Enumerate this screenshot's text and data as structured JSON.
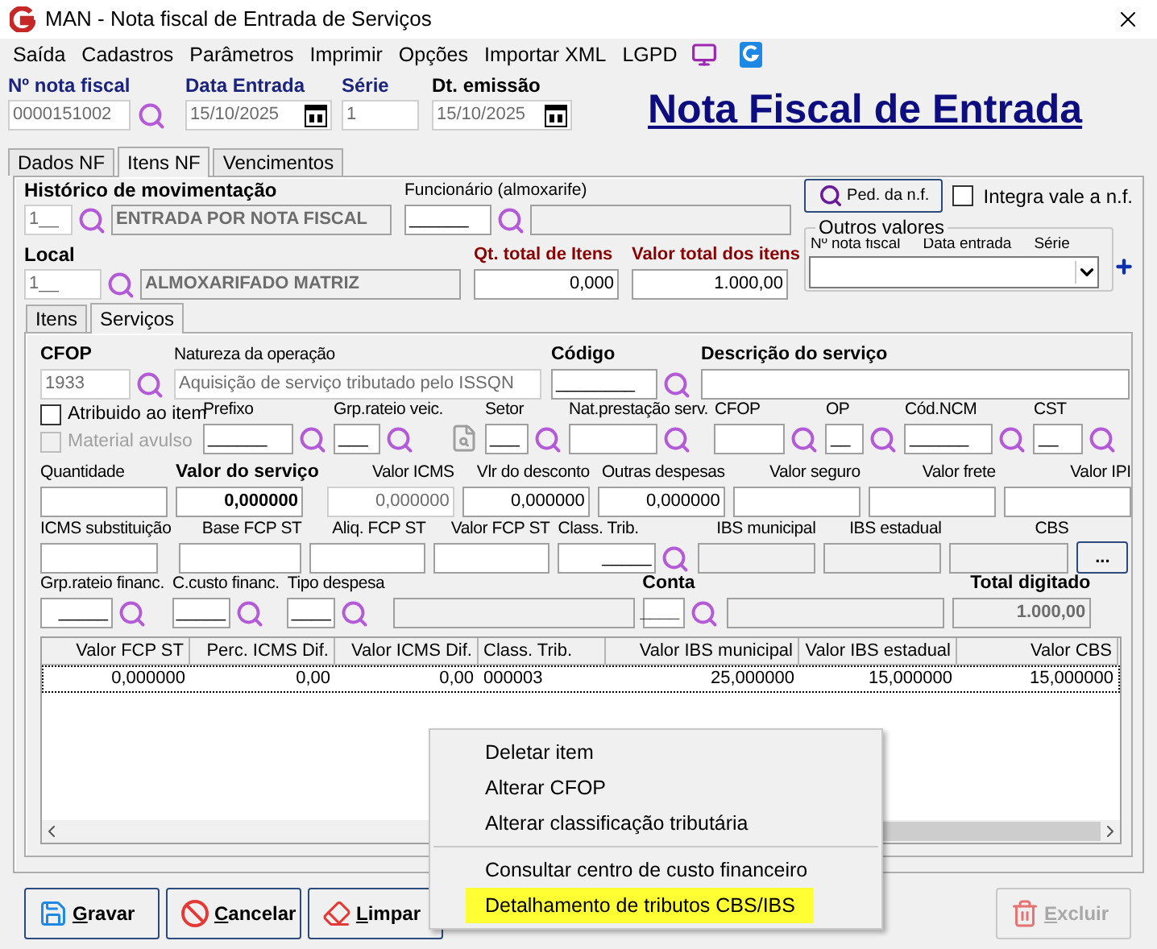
{
  "window": {
    "title": "MAN - Nota fiscal de Entrada de Serviços"
  },
  "menu": [
    "Saída",
    "Cadastros",
    "Parâmetros",
    "Imprimir",
    "Opções",
    "Importar XML",
    "LGPD"
  ],
  "header": {
    "fields": [
      {
        "label": "Nº nota fiscal",
        "value": "0000151002",
        "kind": "search",
        "required": true,
        "readonly": true
      },
      {
        "label": "Data Entrada",
        "value": "15/10/2025",
        "kind": "date",
        "required": true,
        "readonly": true
      },
      {
        "label": "Série",
        "value": "1",
        "kind": "plain",
        "required": true,
        "readonly": true
      },
      {
        "label": "Dt. emissão",
        "value": "15/10/2025",
        "kind": "date",
        "required": false,
        "readonly": true
      }
    ],
    "heading": "Nota Fiscal de Entrada"
  },
  "tabs": [
    {
      "label": "Dados NF",
      "selected": false
    },
    {
      "label": "Itens NF",
      "selected": true
    },
    {
      "label": "Vencimentos",
      "selected": false
    }
  ],
  "historico": {
    "label": "Histórico de movimentação",
    "code": "1__",
    "description": "ENTRADA POR NOTA FISCAL"
  },
  "funcionario": {
    "label": "Funcionário (almoxarife)",
    "code": "______"
  },
  "local": {
    "label": "Local",
    "code": "1__",
    "description": "ALMOXARIFADO MATRIZ"
  },
  "totals": [
    {
      "label": "Qt. total de Itens",
      "value": "0,000"
    },
    {
      "label": "Valor total dos itens",
      "value": "1.000,00"
    }
  ],
  "pedido_button": "Ped. da n.f.",
  "integra_vale": {
    "label": "Integra vale a n.f.",
    "checked": false
  },
  "outros_valores": {
    "title": "Outros valores",
    "columns": [
      "Nº nota fiscal",
      "Data entrada",
      "Série"
    ]
  },
  "inner_tabs": [
    {
      "label": "Itens",
      "selected": false
    },
    {
      "label": "Serviços",
      "selected": true
    }
  ],
  "options": [
    {
      "label": "Atribuido ao item",
      "checked": false,
      "disabled": false
    },
    {
      "label": "Material avulso",
      "checked": false,
      "disabled": true
    }
  ],
  "rows": [
    [
      {
        "label": "CFOP",
        "value": "1933",
        "kind": "search",
        "bold": true,
        "readonly": true,
        "disabled": false
      },
      {
        "label": "Natureza da operação",
        "value": "Aquisição de serviço tributado pelo ISSQN",
        "kind": "plain",
        "bold": false,
        "readonly": true,
        "disabled": false
      },
      {
        "label": "Código",
        "value": "________",
        "kind": "search",
        "bold": true,
        "readonly": false,
        "disabled": false
      },
      {
        "label": "Descrição do serviço",
        "kind": "plain",
        "bold": true,
        "readonly": false,
        "disabled": false
      }
    ],
    [
      {
        "label": "Prefixo",
        "value": "______",
        "kind": "search",
        "bold": false,
        "readonly": false,
        "disabled": false
      },
      {
        "label": "Grp.rateio veic.",
        "value": "___",
        "kind": "search",
        "bold": false,
        "readonly": false,
        "disabled": false
      },
      {
        "label": "Setor",
        "value": "___",
        "kind": "search",
        "bold": false,
        "readonly": false,
        "disabled": false
      },
      {
        "label": "Nat.prestação serv.",
        "kind": "search",
        "bold": false,
        "readonly": false,
        "disabled": false
      },
      {
        "label": "CFOP",
        "kind": "search",
        "bold": false,
        "readonly": false,
        "disabled": false
      },
      {
        "label": "OP",
        "value": "__",
        "kind": "search",
        "bold": false,
        "readonly": false,
        "disabled": false
      },
      {
        "label": "Cód.NCM",
        "value": "______",
        "kind": "search",
        "bold": false,
        "readonly": false,
        "disabled": false
      },
      {
        "label": "CST",
        "value": "__",
        "kind": "search",
        "bold": false,
        "readonly": false,
        "disabled": false
      }
    ],
    [
      {
        "label": "Quantidade",
        "kind": "plain",
        "bold": false,
        "readonly": false,
        "disabled": false
      },
      {
        "label": "Valor do serviço",
        "value": "0,000000",
        "kind": "plain",
        "bold": true,
        "readonly": false,
        "disabled": false
      },
      {
        "label": "Valor ICMS",
        "value": "0,000000",
        "kind": "plain",
        "bold": false,
        "readonly": true,
        "disabled": false
      },
      {
        "label": "Vlr do desconto",
        "value": "0,000000",
        "kind": "plain",
        "bold": false,
        "readonly": false,
        "disabled": false
      },
      {
        "label": "Outras despesas",
        "value": "0,000000",
        "kind": "plain",
        "bold": false,
        "readonly": false,
        "disabled": false
      },
      {
        "label": "Valor seguro",
        "kind": "plain",
        "bold": false,
        "readonly": false,
        "disabled": false
      },
      {
        "label": "Valor frete",
        "kind": "plain",
        "bold": false,
        "readonly": false,
        "disabled": false
      },
      {
        "label": "Valor IPI",
        "kind": "plain",
        "bold": false,
        "readonly": false,
        "disabled": false
      }
    ],
    [
      {
        "label": "ICMS substituição",
        "kind": "plain",
        "bold": false,
        "readonly": false,
        "disabled": false
      },
      {
        "label": "Base FCP ST",
        "kind": "plain",
        "bold": false,
        "readonly": false,
        "disabled": false
      },
      {
        "label": "Aliq. FCP ST",
        "kind": "plain",
        "bold": false,
        "readonly": false,
        "disabled": false
      },
      {
        "label": "Valor FCP ST",
        "kind": "plain",
        "bold": false,
        "readonly": false,
        "disabled": false
      },
      {
        "label": "Class. Trib.",
        "value": "_____",
        "kind": "search",
        "bold": false,
        "readonly": false,
        "disabled": false
      },
      {
        "label": "IBS municipal",
        "kind": "plain",
        "bold": false,
        "readonly": false,
        "disabled": true
      },
      {
        "label": "IBS estadual",
        "kind": "plain",
        "bold": false,
        "readonly": false,
        "disabled": true
      },
      {
        "label": "CBS",
        "kind": "plain",
        "bold": false,
        "readonly": false,
        "disabled": true
      },
      {
        "label": "...",
        "kind": "button"
      }
    ],
    [
      {
        "label": "Grp.rateio financ.",
        "value": "_____",
        "kind": "search",
        "bold": false,
        "readonly": false,
        "disabled": false
      },
      {
        "label": "C.custo financ.",
        "value": "_____",
        "kind": "search",
        "bold": false,
        "readonly": false,
        "disabled": false
      },
      {
        "label": "Tipo despesa",
        "value": "____",
        "kind": "search",
        "bold": false,
        "readonly": false,
        "disabled": false
      },
      {
        "kind": "description",
        "readonly": false,
        "disabled": true
      },
      {
        "label": "Conta",
        "value": "____",
        "kind": "search",
        "bold": true,
        "readonly": false,
        "disabled": false
      },
      {
        "kind": "description",
        "readonly": false,
        "disabled": true
      },
      {
        "label": "Total digitado",
        "value": "1.000,00",
        "kind": "plain",
        "bold": true,
        "readonly": false,
        "disabled": true
      }
    ]
  ],
  "grid": {
    "columns": [
      "Valor FCP ST",
      "Perc. ICMS Dif.",
      "Valor ICMS Dif.",
      "Class. Trib.",
      "Valor IBS municipal",
      "Valor IBS estadual",
      "Valor CBS"
    ],
    "rows": [
      {
        "cells": [
          "0,000000",
          "0,00",
          "0,00",
          "000003",
          "25,000000",
          "15,000000",
          "15,000000"
        ],
        "selected": true
      }
    ]
  },
  "context_menu": [
    {
      "label": "Deletar item",
      "separator_before": false,
      "highlighted": false
    },
    {
      "label": "Alterar CFOP",
      "separator_before": false,
      "highlighted": false
    },
    {
      "label": "Alterar classificação tributária",
      "separator_before": false,
      "highlighted": false
    },
    {
      "label": "Consultar centro de custo financeiro",
      "separator_before": true,
      "highlighted": false
    },
    {
      "label": "Detalhamento de tributos CBS/IBS",
      "separator_before": false,
      "highlighted": true
    }
  ],
  "buttons": [
    {
      "label": "Gravar",
      "kind": "save",
      "disabled": false
    },
    {
      "label": "Cancelar",
      "kind": "cancel",
      "disabled": false
    },
    {
      "label": "Limpar",
      "kind": "clear",
      "disabled": false
    },
    {
      "label": "Excluir",
      "kind": "delete",
      "disabled": true
    }
  ]
}
